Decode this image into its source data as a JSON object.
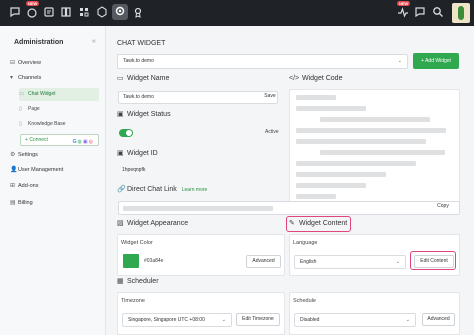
{
  "topbar": {
    "icons": [
      "chat-icon",
      "inbox-icon",
      "book-icon",
      "grid-icon",
      "cube-icon",
      "settings-icon",
      "rocket-icon",
      "pulse-icon",
      "chat-bubble-icon",
      "search-icon"
    ],
    "badge_new": "NEW",
    "badge_new2": "NEW"
  },
  "sidebar": {
    "title": "Administration",
    "collapse": "«",
    "overview": "Overview",
    "channels": "Channels",
    "chat_widget": "Chat Widget",
    "page": "Page",
    "knowledge_base": "Knowledge Base",
    "connect": "Connect",
    "settings": "Settings",
    "user_management": "User Management",
    "add_ons": "Add-ons",
    "billing": "Billing"
  },
  "main": {
    "title": "CHAT WIDGET",
    "widget_select": "Tawk.to demo",
    "add_widget": "+ Add Widget",
    "widget_name": {
      "heading": "Widget Name",
      "value": "Tawk.to demo",
      "save": "Save"
    },
    "widget_code": {
      "heading": "Widget Code"
    },
    "widget_status": {
      "heading": "Widget Status",
      "status": "Active"
    },
    "widget_id": {
      "heading": "Widget ID",
      "value": "1hpeqnpfk"
    },
    "direct_chat_link": {
      "heading": "Direct Chat Link",
      "learn_more": "Learn more",
      "copy": "Copy"
    },
    "widget_appearance": {
      "heading": "Widget Appearance",
      "color_label": "Widget Color",
      "color_value": "#03a84e",
      "advanced": "Advanced"
    },
    "widget_content": {
      "heading": "Widget Content",
      "language_label": "Language",
      "language_value": "English",
      "edit_content": "Edit Content"
    },
    "scheduler": {
      "heading": "Scheduler",
      "timezone_label": "Timezone",
      "timezone_value": "Singapore, Singapore UTC +08:00",
      "edit_timezone": "Edit Timezone",
      "schedule_label": "Schedule",
      "schedule_value": "Disabled",
      "advanced": "Advanced"
    }
  },
  "colors": {
    "accent": "#2fa84f",
    "widget_color": "#03a84e",
    "highlight": "#e0457b",
    "topbar": "#1f2226"
  }
}
